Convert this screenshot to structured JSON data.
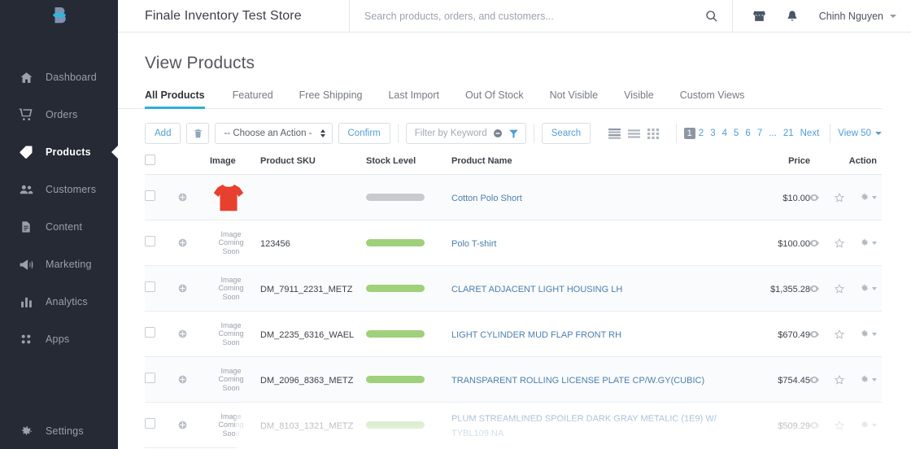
{
  "sidebar": {
    "logo_name": "bigcommerce-logo",
    "items": [
      {
        "label": "Dashboard",
        "icon": "home-icon",
        "active": false
      },
      {
        "label": "Orders",
        "icon": "cart-icon",
        "active": false
      },
      {
        "label": "Products",
        "icon": "tag-icon",
        "active": true
      },
      {
        "label": "Customers",
        "icon": "users-icon",
        "active": false
      },
      {
        "label": "Content",
        "icon": "document-icon",
        "active": false
      },
      {
        "label": "Marketing",
        "icon": "megaphone-icon",
        "active": false
      },
      {
        "label": "Analytics",
        "icon": "bar-chart-icon",
        "active": false
      },
      {
        "label": "Apps",
        "icon": "grid-dots-icon",
        "active": false
      }
    ],
    "settings": {
      "label": "Settings",
      "icon": "gear-icon"
    }
  },
  "topbar": {
    "store_title": "Finale Inventory Test Store",
    "search_placeholder": "Search products, orders, and customers...",
    "search_value": "",
    "storefront_icon": "storefront-icon",
    "notifications_icon": "bell-icon",
    "user_name": "Chinh Nguyen"
  },
  "page": {
    "title": "View Products"
  },
  "tabs": [
    {
      "label": "All Products",
      "active": true
    },
    {
      "label": "Featured",
      "active": false
    },
    {
      "label": "Free Shipping",
      "active": false
    },
    {
      "label": "Last Import",
      "active": false
    },
    {
      "label": "Out Of Stock",
      "active": false
    },
    {
      "label": "Not Visible",
      "active": false
    },
    {
      "label": "Visible",
      "active": false
    },
    {
      "label": "Custom Views",
      "active": false
    }
  ],
  "toolbar": {
    "add_label": "Add",
    "delete_icon": "trash-icon",
    "action_select": "-- Choose an Action -",
    "confirm_label": "Confirm",
    "filter_placeholder": "Filter by Keyword",
    "filter_value": "",
    "clear_icon": "clear-circle-icon",
    "funnel_icon": "funnel-icon",
    "search_label": "Search",
    "view_modes": [
      "list-compact-icon",
      "list-rows-icon",
      "grid-icon"
    ],
    "pagination": {
      "current": "1",
      "pages": [
        "2",
        "3",
        "4",
        "5",
        "6",
        "7"
      ],
      "ellipsis": "...",
      "last": "21",
      "next_label": "Next"
    },
    "view_count_label": "View 50"
  },
  "table": {
    "headers": {
      "checkbox": "",
      "plus": "",
      "image": "Image",
      "sku": "Product SKU",
      "stock": "Stock Level",
      "name": "Product Name",
      "price": "Price",
      "action": "Action"
    },
    "image_placeholder": "Image\nComing\nSoon",
    "image_placeholder_l1": "Image",
    "image_placeholder_l2": "Coming",
    "image_placeholder_l3": "Soon",
    "rows": [
      {
        "sku": "",
        "image_type": "tshirt-red",
        "stock_color": "#c8cacd",
        "name": "Cotton Polo Short",
        "price": "$10.00"
      },
      {
        "sku": "123456",
        "image_type": "placeholder",
        "stock_color": "#9fd07a",
        "name": "Polo T-shirt",
        "price": "$100.00"
      },
      {
        "sku": "DM_7911_2231_METZ",
        "image_type": "placeholder",
        "stock_color": "#9fd07a",
        "name": "CLARET ADJACENT LIGHT HOUSING LH",
        "price": "$1,355.28"
      },
      {
        "sku": "DM_2235_6316_WAEL",
        "image_type": "placeholder",
        "stock_color": "#9fd07a",
        "name": "LIGHT CYLINDER MUD FLAP FRONT RH",
        "price": "$670.49"
      },
      {
        "sku": "DM_2096_8363_METZ",
        "image_type": "placeholder",
        "stock_color": "#9fd07a",
        "name": "TRANSPARENT ROLLING LICENSE PLATE CP/W.GY(CUBIC)",
        "price": "$754.45"
      },
      {
        "sku": "DM_8103_1321_METZ",
        "image_type": "placeholder",
        "stock_color": "#9fd07a",
        "name": "PLUM STREAMLINED SPOILER DARK GRAY METALIC (1E9) W/ TYBL109 NA",
        "price": "$509.29"
      }
    ],
    "row_actions": {
      "preview_icon": "eye-icon",
      "favorite_icon": "star-icon",
      "settings_icon": "gear-icon"
    }
  },
  "colors": {
    "sidebar_bg": "#252A35",
    "accent_blue": "#2faede",
    "link_blue": "#4f9ed8",
    "stock_green": "#9fd07a",
    "stock_gray": "#c8cacd",
    "tshirt_red": "#e8402e"
  }
}
